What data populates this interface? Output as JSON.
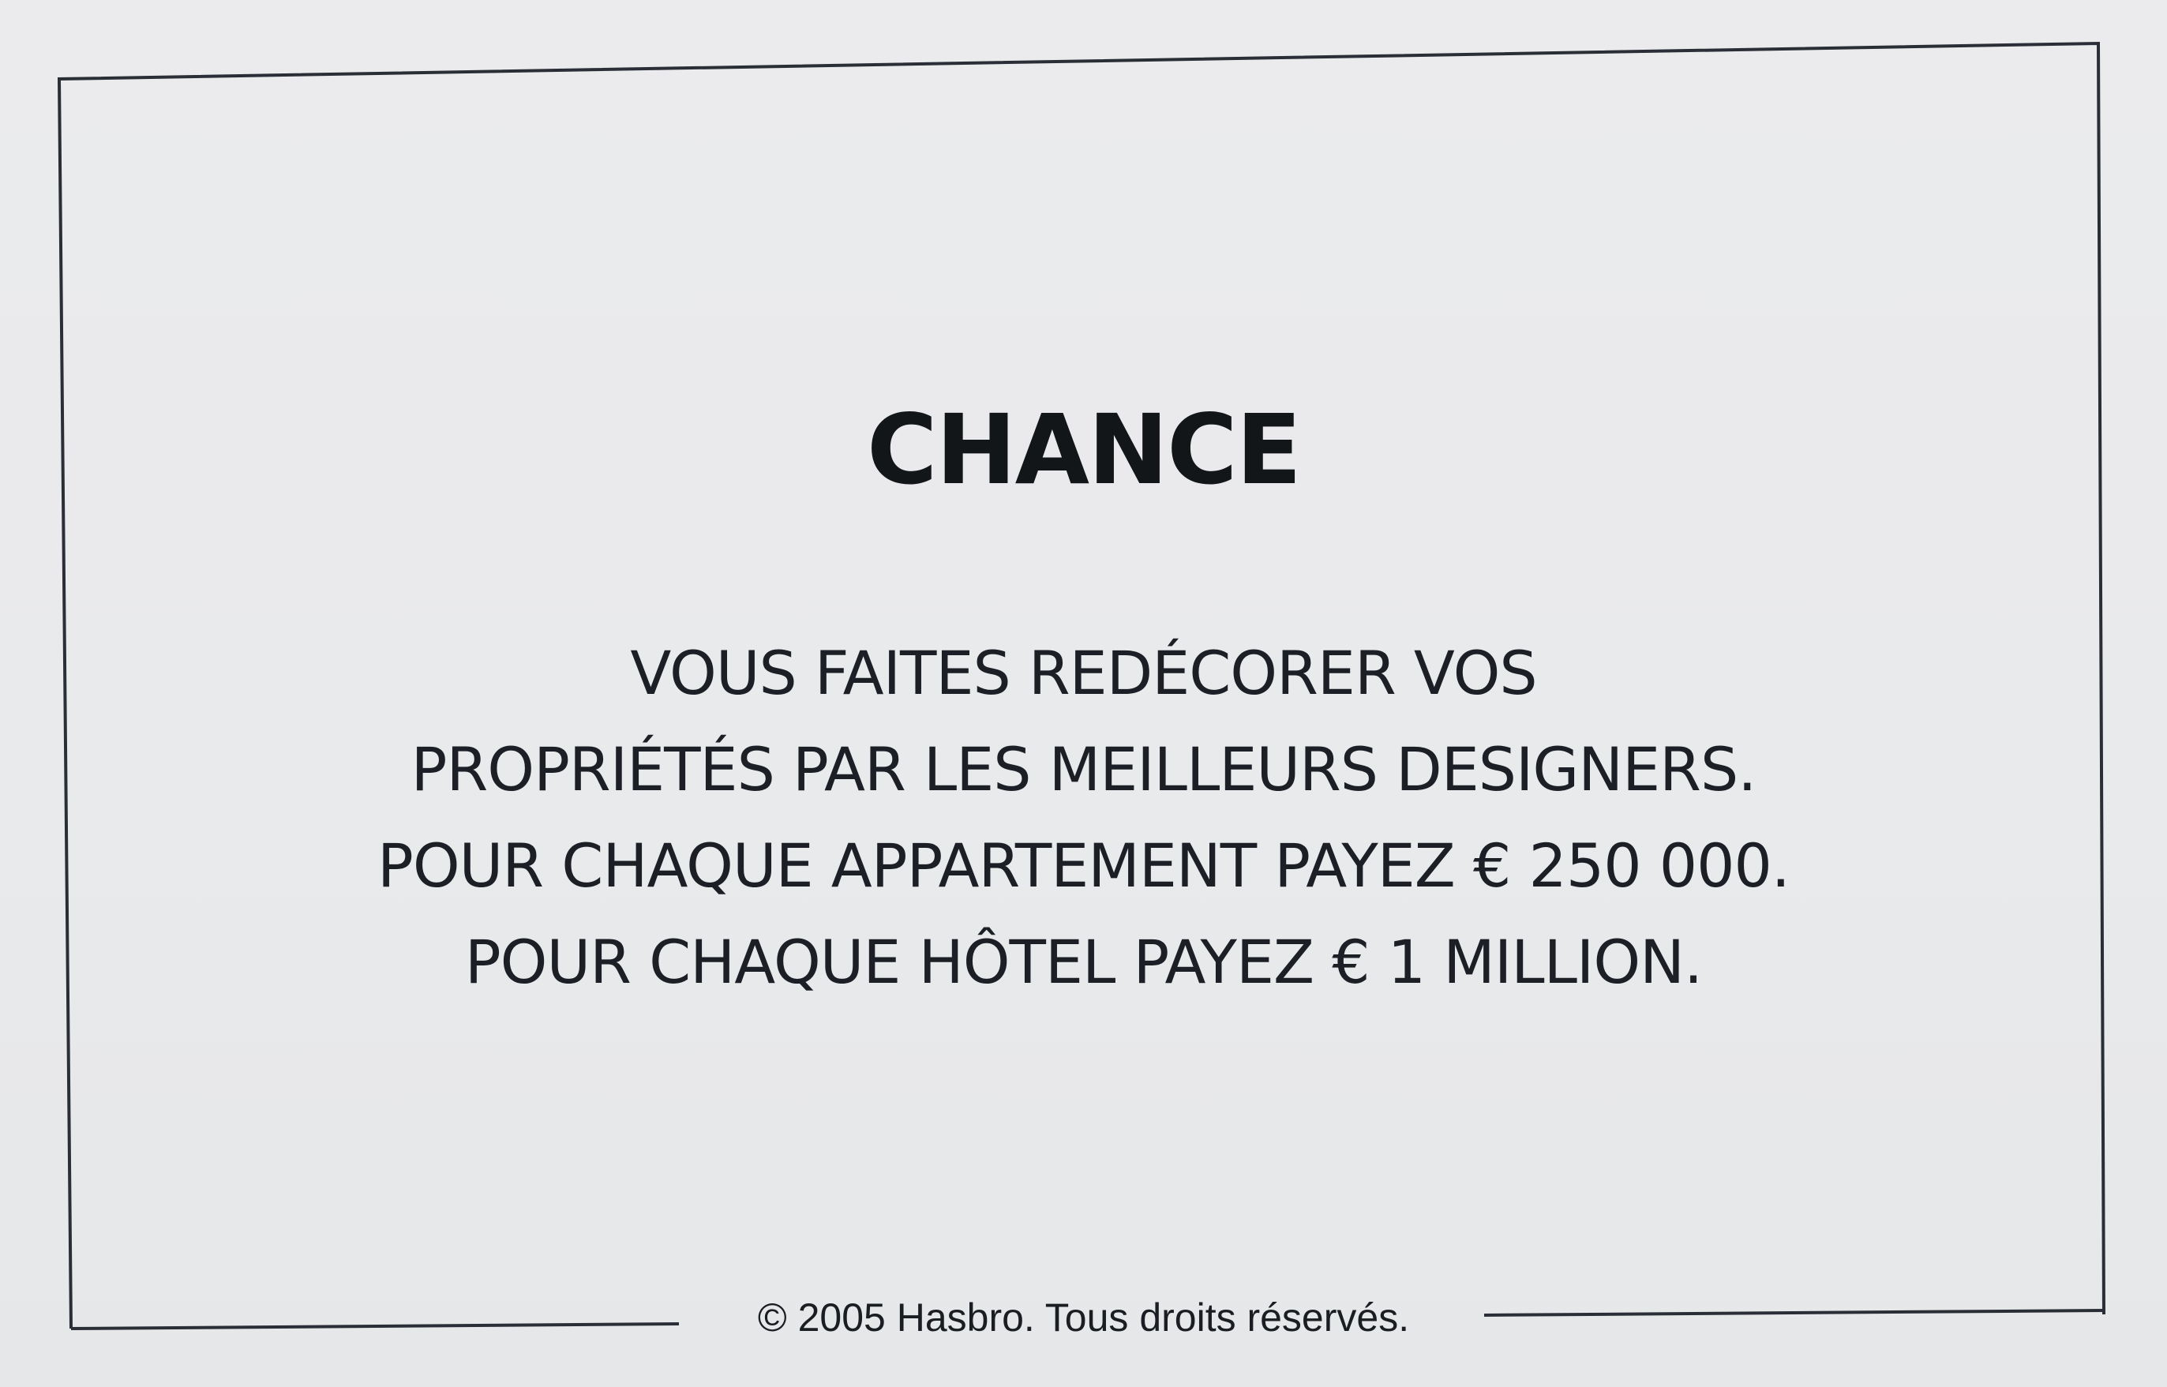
{
  "card": {
    "title": "CHANCE",
    "lines": [
      "VOUS FAITES REDÉCORER VOS",
      "PROPRIÉTÉS PAR LES MEILLEURS DESIGNERS.",
      "POUR CHAQUE APPARTEMENT PAYEZ € 250 000.",
      "POUR CHAQUE HÔTEL PAYEZ € 1 MILLION."
    ],
    "copyright": "© 2005 Hasbro. Tous droits réservés."
  },
  "colors": {
    "background": "#e9eaec",
    "ink": "#1c2026",
    "border": "#2a2e36"
  }
}
